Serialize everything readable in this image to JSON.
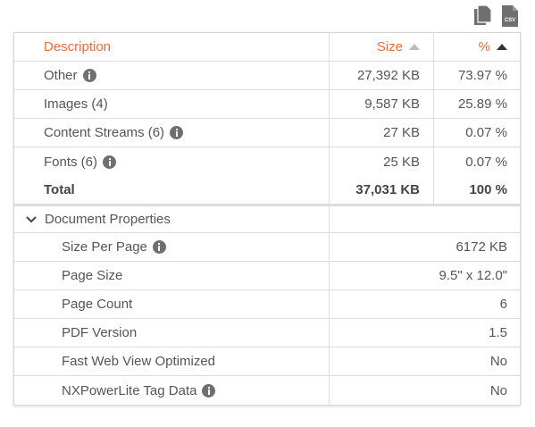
{
  "toolbar": {
    "copy_icon": "copy-icon",
    "csv_label": "CSV"
  },
  "colors": {
    "accent": "#ee6a3c",
    "info_icon": "#6f6f6f",
    "border": "#dcdcdc"
  },
  "table": {
    "headers": {
      "description": "Description",
      "size": "Size",
      "percent": "%"
    },
    "rows": [
      {
        "description": "Other",
        "size": "27,392 KB",
        "percent": "73.97 %",
        "info": true
      },
      {
        "description": "Images (4)",
        "size": "9,587 KB",
        "percent": "25.89 %",
        "info": false
      },
      {
        "description": "Content Streams (6)",
        "size": "27 KB",
        "percent": "0.07 %",
        "info": true
      },
      {
        "description": "Fonts (6)",
        "size": "25 KB",
        "percent": "0.07 %",
        "info": true
      }
    ],
    "total": {
      "description": "Total",
      "size": "37,031 KB",
      "percent": "100 %"
    }
  },
  "document_properties": {
    "title": "Document Properties",
    "items": [
      {
        "label": "Size Per Page",
        "value": "6172 KB",
        "info": true
      },
      {
        "label": "Page Size",
        "value": "9.5\" x 12.0\"",
        "info": false
      },
      {
        "label": "Page Count",
        "value": "6",
        "info": false
      },
      {
        "label": "PDF Version",
        "value": "1.5",
        "info": false
      },
      {
        "label": "Fast Web View Optimized",
        "value": "No",
        "info": false
      },
      {
        "label": "NXPowerLite Tag Data",
        "value": "No",
        "info": true
      }
    ]
  }
}
